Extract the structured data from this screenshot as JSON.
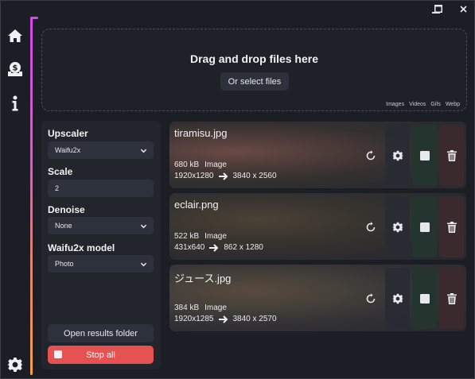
{
  "window": {
    "minimize_icon": "minimize-icon",
    "maximize_icon": "maximize-icon",
    "close_icon": "close-icon"
  },
  "sidebar": {
    "items": [
      {
        "name": "home",
        "icon": "home-icon"
      },
      {
        "name": "donate",
        "icon": "dollar-bag-icon"
      },
      {
        "name": "info",
        "icon": "info-icon"
      }
    ],
    "settings_icon": "gear-icon",
    "accent_colors": [
      "#d946ef",
      "#f5a04a"
    ]
  },
  "dropzone": {
    "title": "Drag and drop files here",
    "select_button": "Or select files",
    "formats": [
      "Images",
      "Videos",
      "Gifs",
      "Webp"
    ]
  },
  "settings": {
    "upscaler_label": "Upscaler",
    "upscaler_value": "Waifu2x",
    "scale_label": "Scale",
    "scale_value": "2",
    "denoise_label": "Denoise",
    "denoise_value": "None",
    "model_label": "Waifu2x model",
    "model_value": "Photo",
    "open_folder": "Open results folder",
    "stop_all": "Stop all",
    "stop_color": "#e65252"
  },
  "files": [
    {
      "name": "tiramisu.jpg",
      "size": "680 kB",
      "type": "Image",
      "from": "1920x1280",
      "to": "3840 x 2560"
    },
    {
      "name": "eclair.png",
      "size": "522 kB",
      "type": "Image",
      "from": "431x640",
      "to": "862 x 1280"
    },
    {
      "name": "ジュース.jpg",
      "size": "384 kB",
      "type": "Image",
      "from": "1920x1285",
      "to": "3840 x 2570"
    }
  ],
  "card_buttons": [
    "refresh-icon",
    "gear-icon",
    "stop-icon",
    "trash-icon"
  ]
}
